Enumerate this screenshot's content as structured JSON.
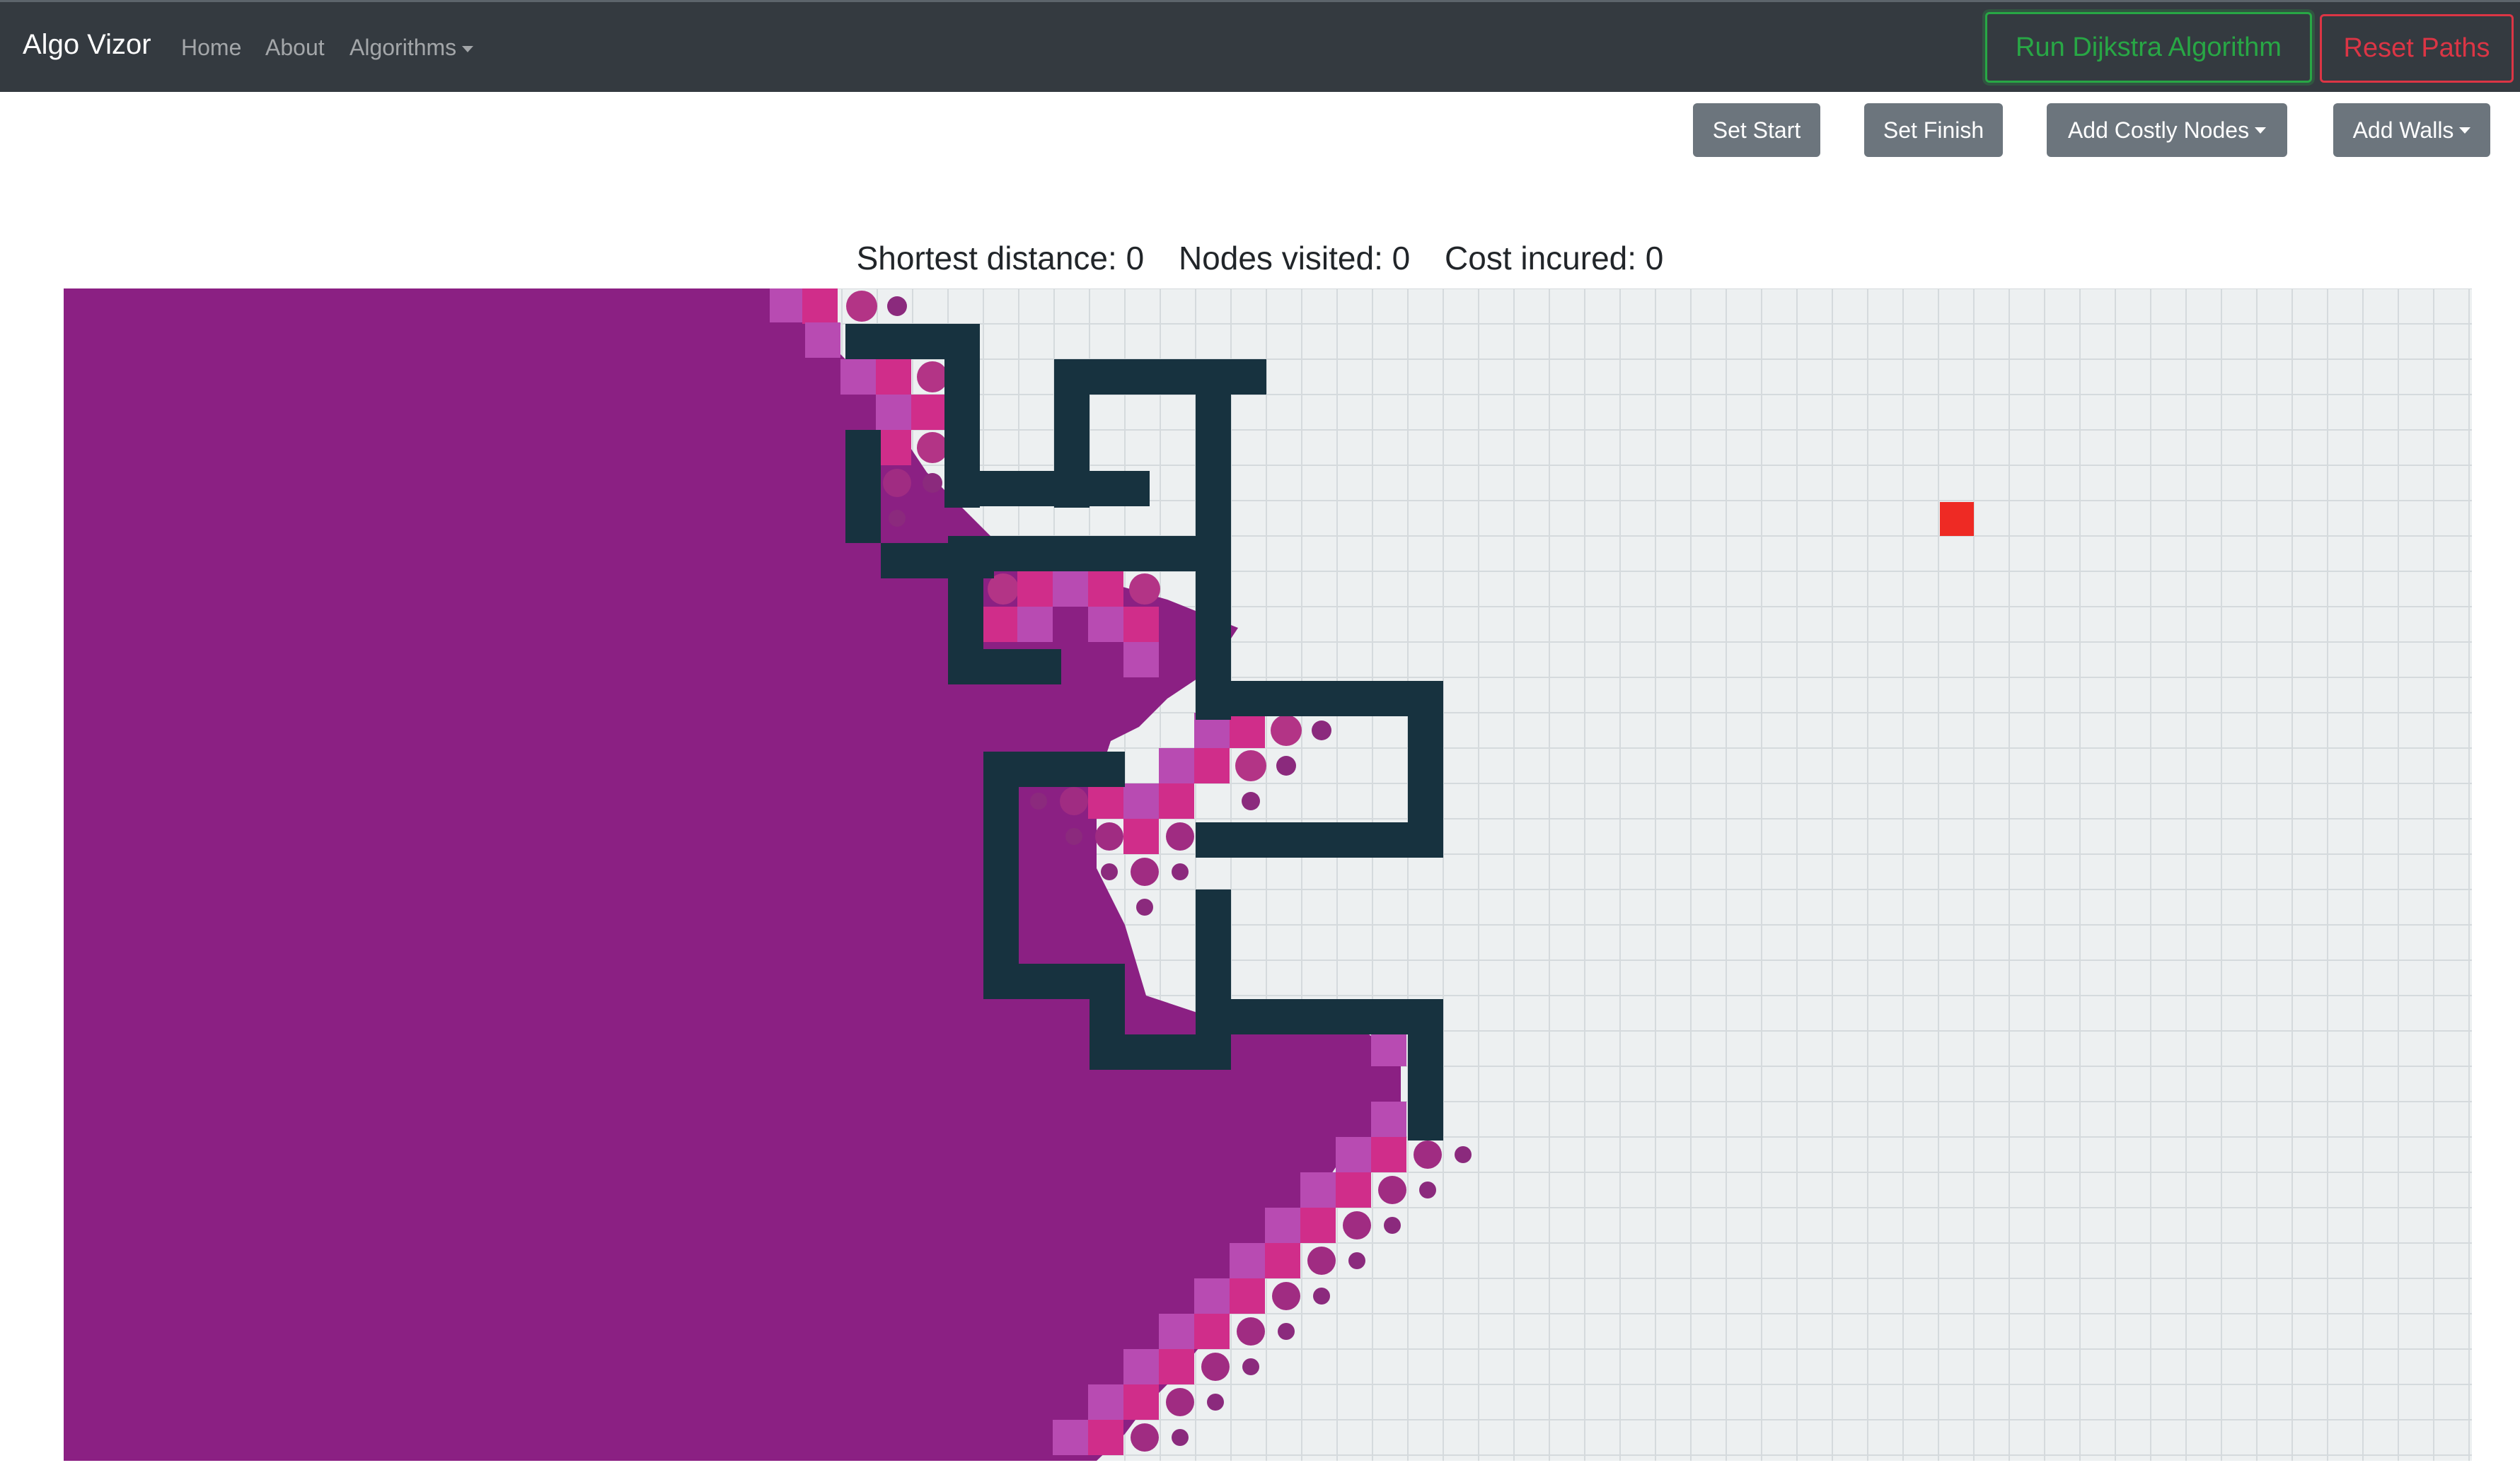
{
  "navbar": {
    "brand": "Algo Vizor",
    "links": [
      {
        "label": "Home"
      },
      {
        "label": "About"
      },
      {
        "label": "Algorithms"
      }
    ],
    "run_button": "Run Dijkstra Algorithm",
    "reset_button": "Reset Paths"
  },
  "toolbar": {
    "set_start": "Set Start",
    "set_finish": "Set Finish",
    "add_costly_nodes": "Add Costly Nodes",
    "add_walls": "Add Walls"
  },
  "stats": {
    "shortest_distance": "Shortest distance: 0",
    "nodes_visited": "Nodes visited: 0",
    "cost_incurred": "Cost incured: 0"
  },
  "colors": {
    "visited": "#8b2083",
    "wall": "#17323f",
    "finish": "#ee2a24",
    "frontier_pink": "#d02d8a",
    "frontier_lilac": "#b84bb2",
    "grid_bg": "#edf0f1",
    "grid_line": "#d5dadd"
  }
}
